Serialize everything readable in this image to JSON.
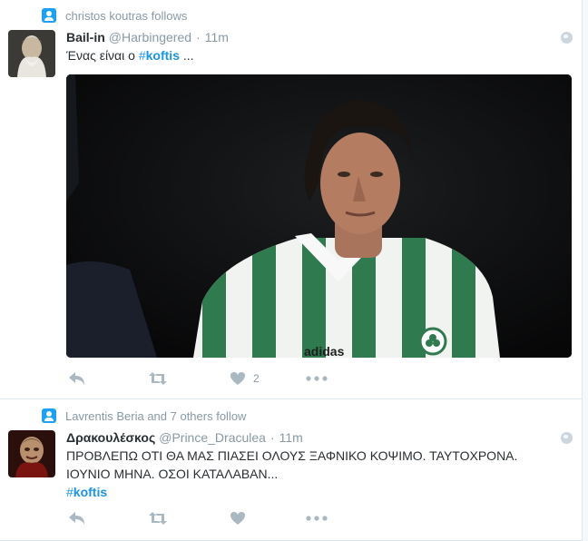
{
  "tweets": [
    {
      "context": "christos koutras follows",
      "name": "Bail-in",
      "handle": "@Harbingered",
      "time": "11m",
      "text_prefix": "Ένας είναι ο ",
      "hash_symbol": "#",
      "hash_word": "koftis",
      "text_suffix": " ...",
      "like_count": "2",
      "media_text": "adidas"
    },
    {
      "context": "Lavrentis Beria and 7 others follow",
      "name": "Δρακουλέσκος",
      "handle": "@Prince_Draculea",
      "time": "11m",
      "line1": "ΠΡΟΒΛΕΠΩ ΟΤΙ ΘΑ ΜΑΣ ΠΙΑΣΕΙ ΟΛΟΥΣ ΞΑΦΝΙΚΟ ΚΟΨΙΜΟ. ΤΑΥΤΟΧΡΟΝΑ.",
      "line2": "ΙΟΥΝΙΟ ΜΗΝΑ. ΟΣΟΙ ΚΑΤΑΛΑΒΑΝ...",
      "hash_symbol": "#",
      "hash_word": "koftis"
    }
  ],
  "separator": "·",
  "colors": {
    "link": "#1b95e0",
    "muted": "#8899a6",
    "action": "#aab8c2",
    "context_icon": "#1da1f2"
  }
}
